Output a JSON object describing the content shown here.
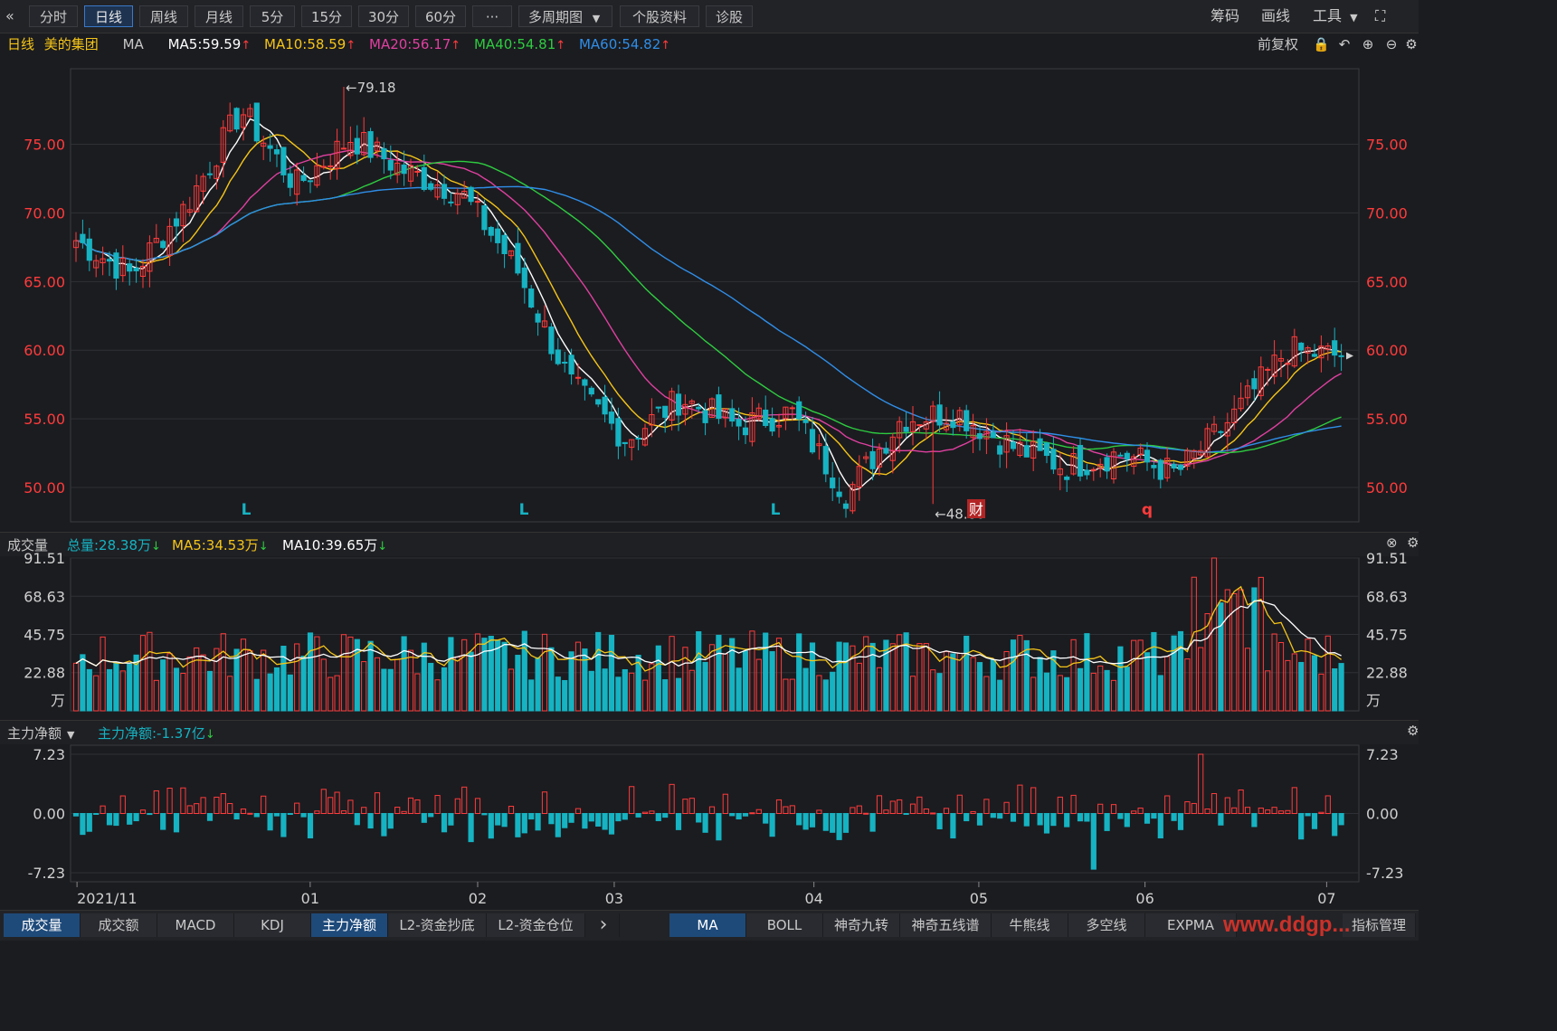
{
  "topbar": {
    "back_icon": "«",
    "periods": [
      "分时",
      "日线",
      "周线",
      "月线",
      "5分",
      "15分",
      "30分",
      "60分"
    ],
    "active_period": "日线",
    "more": "···",
    "multi_period": "多周期图",
    "stock_info": "个股资料",
    "diagnose": "诊股",
    "right": [
      "筹码",
      "画线",
      "工具"
    ],
    "expand_icon": "⛶"
  },
  "main_legend": {
    "period": "日线",
    "stock": "美的集团",
    "indicator": "MA",
    "ma5": "MA5:59.59",
    "ma10": "MA10:58.59",
    "ma20": "MA20:56.17",
    "ma40": "MA40:54.81",
    "ma60": "MA60:54.82",
    "adjust": "前复权"
  },
  "vol_legend": {
    "title": "成交量",
    "total": "总量:28.38万",
    "ma5": "MA5:34.53万",
    "ma10": "MA10:39.65万"
  },
  "flow_legend": {
    "title": "主力净额",
    "value": "主力净额:-1.37亿"
  },
  "colors": {
    "up": "#ff3b3b",
    "down": "#16b3c2",
    "ma5": "#ffffff",
    "ma10": "#f5c518",
    "ma20": "#e040a0",
    "ma40": "#2ecc40",
    "ma60": "#2f8ee8",
    "axis_text": "#ff3b3b",
    "signal": "#16b3c2"
  },
  "markers": {
    "high": "←79.18",
    "low": "←48.80",
    "events": [
      "L",
      "L",
      "L",
      "财",
      "q"
    ]
  },
  "bottombar": {
    "left_tabs": [
      "成交量",
      "成交额",
      "MACD",
      "KDJ",
      "主力净额",
      "L2-资金抄底",
      "L2-资金仓位"
    ],
    "left_active": [
      "成交量",
      "主力净额"
    ],
    "next_icon": "›",
    "right_tabs": [
      "MA",
      "BOLL",
      "神奇九转",
      "神奇五线谱",
      "牛熊线",
      "多空线",
      "EXPMA"
    ],
    "right_active": "MA",
    "indicator_manage": "指标管理",
    "watermark": "www.ddgp..."
  },
  "chart_data": [
    {
      "type": "candlestick",
      "title": "日线 美的集团",
      "yticks": [
        "75.00",
        "70.00",
        "65.00",
        "60.00",
        "55.00",
        "50.00"
      ],
      "ylim": [
        47.5,
        80.5
      ],
      "xticks": [
        "2021/11",
        "01",
        "02",
        "03",
        "04",
        "05",
        "06",
        "07"
      ],
      "high_label": 79.18,
      "low_label": 48.8,
      "key_points": [
        {
          "date": "2021/11",
          "close": 68.0
        },
        {
          "date": "2021/11 low",
          "close": 65.5
        },
        {
          "date": "2021/12",
          "close": 70.5
        },
        {
          "date": "2022/01 high",
          "close": 77.5
        },
        {
          "date": "2022/01",
          "close": 72.0
        },
        {
          "date": "2022/01 peak2",
          "close": 75.5
        },
        {
          "date": "2022/02",
          "close": 73.0
        },
        {
          "date": "2022/02 end",
          "close": 71.5
        },
        {
          "date": "2022/03",
          "close": 66.0
        },
        {
          "date": "2022/03 mid",
          "close": 57.5
        },
        {
          "date": "2022/03 low",
          "close": 53.5
        },
        {
          "date": "2022/04",
          "close": 56.5
        },
        {
          "date": "2022/04 mid",
          "close": 54.5
        },
        {
          "date": "2022/04 end",
          "close": 55.5
        },
        {
          "date": "2022/04 low",
          "close": 49.5
        },
        {
          "date": "2022/05",
          "close": 55.0
        },
        {
          "date": "2022/05 mid",
          "close": 55.5
        },
        {
          "date": "2022/05 end",
          "close": 53.0
        },
        {
          "date": "2022/06",
          "close": 51.5
        },
        {
          "date": "2022/06 mid",
          "close": 52.5
        },
        {
          "date": "2022/06 low",
          "close": 51.0
        },
        {
          "date": "2022/06 end",
          "close": 55.0
        },
        {
          "date": "2022/07",
          "close": 60.0
        },
        {
          "date": "2022/07 last",
          "close": 59.59
        }
      ],
      "ma": [
        {
          "name": "MA5",
          "last": 59.59
        },
        {
          "name": "MA10",
          "last": 58.59
        },
        {
          "name": "MA20",
          "last": 56.17
        },
        {
          "name": "MA40",
          "last": 54.81
        },
        {
          "name": "MA60",
          "last": 54.82
        }
      ]
    },
    {
      "type": "bar",
      "title": "成交量",
      "unit": "万",
      "yticks": [
        "91.51",
        "68.63",
        "45.75",
        "22.88"
      ],
      "ylim": [
        0,
        91.51
      ],
      "last": 28.38,
      "ma5_last": 34.53,
      "ma10_last": 39.65
    },
    {
      "type": "bar",
      "title": "主力净额",
      "yticks": [
        "7.23",
        "0.00",
        "-7.23"
      ],
      "ylim": [
        -7.23,
        7.23
      ],
      "last": -1.37,
      "unit": "亿"
    }
  ]
}
